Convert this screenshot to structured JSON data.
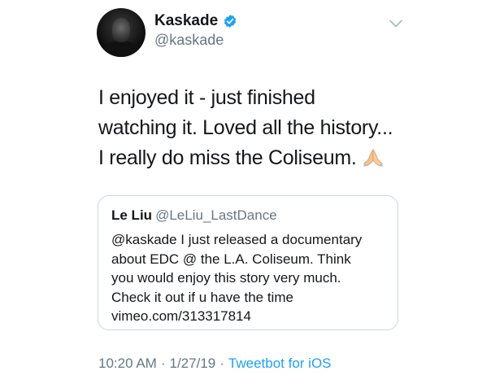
{
  "user": {
    "display_name": "Kaskade",
    "handle": "@kaskade",
    "verified": true
  },
  "tweet": {
    "lines": [
      "I enjoyed it - just finished",
      "watching it. Loved all the history...",
      "I really do miss the Coliseum."
    ],
    "emoji": "folded-hands-emoji"
  },
  "quote": {
    "name": "Le Liu",
    "handle": "@LeLiu_LastDance",
    "lines": [
      "@kaskade I just released a documentary",
      "about EDC @ the L.A. Coliseum. Think",
      "you would enjoy this story very much.",
      "Check it out if u have the time",
      "vimeo.com/313317814"
    ]
  },
  "meta": {
    "time": "10:20 AM",
    "date": "1/27/19",
    "separator": "·",
    "source": "Tweetbot for iOS"
  },
  "colors": {
    "text": "#14171a",
    "secondary": "#657786",
    "accent": "#1da1f2",
    "border": "#ccd6dd"
  }
}
